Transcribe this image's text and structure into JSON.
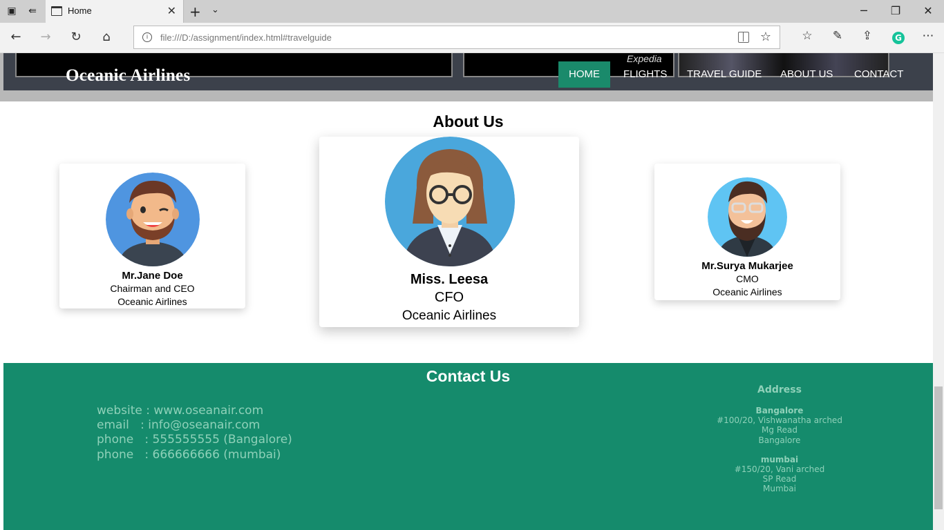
{
  "browser": {
    "tab_title": "Home",
    "url": "file:///D:/assignment/index.html#travelguide"
  },
  "site": {
    "brand": "Oceanic Airlines",
    "banner_text": "Expedia",
    "nav": [
      "HOME",
      "FLIGHTS",
      "TRAVEL GUIDE",
      "ABOUT US",
      "CONTACT"
    ],
    "active_nav": "HOME"
  },
  "about": {
    "title": "About Us",
    "members": [
      {
        "name": "Mr.Jane Doe",
        "role": "Chairman and CEO",
        "company": "Oceanic Airlines"
      },
      {
        "name": "Miss. Leesa",
        "role": "CFO",
        "company": "Oceanic Airlines"
      },
      {
        "name": "Mr.Surya Mukarjee",
        "role": "CMO",
        "company": "Oceanic Airlines"
      }
    ]
  },
  "contact": {
    "title": "Contact Us",
    "lines": [
      "website : www.oseanair.com",
      "email   : info@oseanair.com",
      "phone   : 555555555 (Bangalore)",
      "phone   : 666666666 (mumbai)"
    ],
    "address_heading": "Address",
    "offices": [
      {
        "city": "Bangalore",
        "lines": [
          "#100/20, Vishwanatha arched",
          "Mg Read",
          "Bangalore"
        ]
      },
      {
        "city": "mumbai",
        "lines": [
          "#150/20, Vani arched",
          "SP Read",
          "Mumbai"
        ]
      }
    ]
  },
  "colors": {
    "accent": "#1a8a6b",
    "footer": "#158b6c",
    "header": "#3c414b"
  }
}
